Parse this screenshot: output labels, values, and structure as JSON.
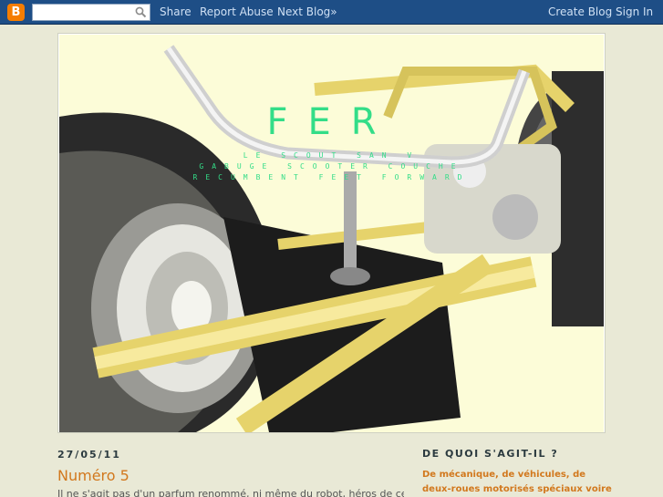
{
  "navbar": {
    "logo": "B",
    "search_value": "",
    "links": [
      "Share",
      "Report Abuse",
      "Next Blog»",
      "Create Blog",
      "Sign In"
    ]
  },
  "header": {
    "title": "FER",
    "description": [
      "LE SCOUT SAN V",
      "GABUGE SCOOTER COUCHE",
      "RECUMBENT FEET FORWARD"
    ]
  },
  "post": {
    "date": "27/05/11",
    "title": "Numéro 5",
    "body_start": "Il ne s'agit pas d'un parfum renommé, ni même du robot, héros de certaines"
  },
  "sidebar": {
    "title": "DE QUOI S'AGIT-IL ?",
    "text": "De mécanique, de véhicules, de deux-roues motorisés spéciaux voire"
  },
  "colors": {
    "navbar": "#1e4e86",
    "accent": "#d2781d",
    "title_green": "#33dd88"
  }
}
